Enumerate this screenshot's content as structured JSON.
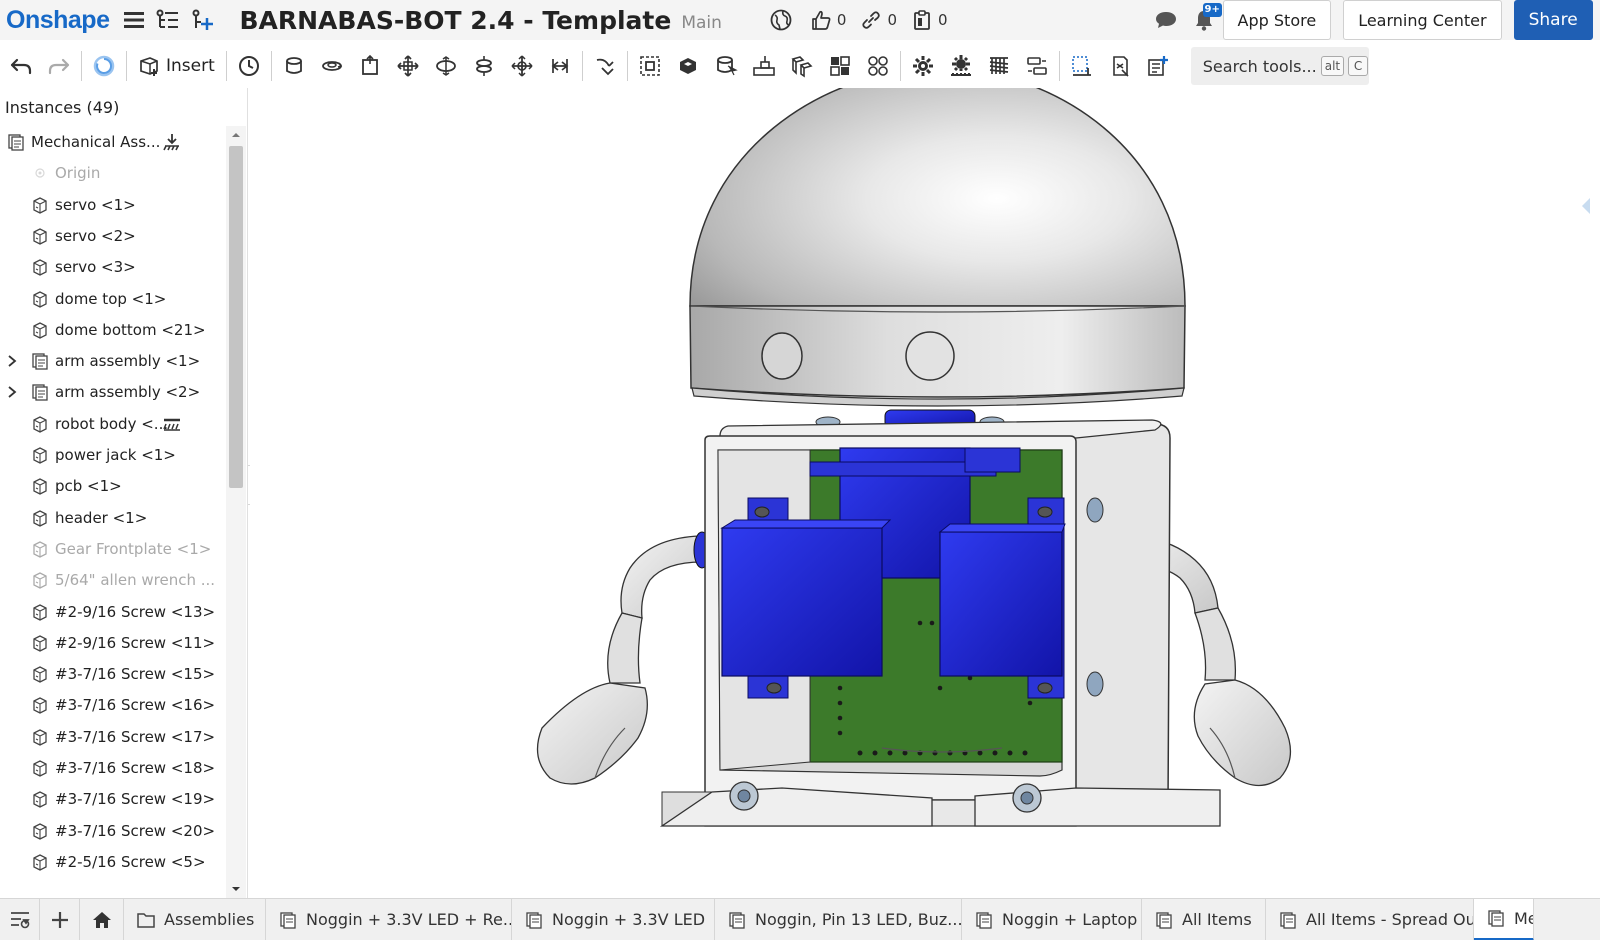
{
  "header": {
    "logo": "Onshape",
    "document_title": "BARNABAS-BOT 2.4 - Template",
    "branch": "Main",
    "likes": "0",
    "links": "0",
    "copies": "0",
    "notification_badge": "9+",
    "app_store": "App Store",
    "learning_center": "Learning Center",
    "share": "Share"
  },
  "toolbar": {
    "insert_label": "Insert",
    "search_placeholder": "Search tools...",
    "shortcut_key1": "alt",
    "shortcut_key2": "C"
  },
  "panel": {
    "title": "Instances (49)",
    "items": [
      {
        "label": "Mechanical Ass...",
        "icon": "assembly-icon",
        "level": 0,
        "state": "normal",
        "caret": false,
        "suffix": "ground-icon"
      },
      {
        "label": "Origin",
        "icon": "origin-icon",
        "level": 1,
        "state": "dim",
        "caret": false
      },
      {
        "label": "servo <1>",
        "icon": "part-icon",
        "level": 1,
        "state": "normal",
        "caret": false
      },
      {
        "label": "servo <2>",
        "icon": "part-icon",
        "level": 1,
        "state": "normal",
        "caret": false
      },
      {
        "label": "servo <3>",
        "icon": "part-icon",
        "level": 1,
        "state": "normal",
        "caret": false
      },
      {
        "label": "dome top <1>",
        "icon": "part-icon",
        "level": 1,
        "state": "normal",
        "caret": false
      },
      {
        "label": "dome bottom <21>",
        "icon": "part-icon",
        "level": 1,
        "state": "normal",
        "caret": false
      },
      {
        "label": "arm assembly <1>",
        "icon": "assembly-icon",
        "level": 1,
        "state": "normal",
        "caret": true
      },
      {
        "label": "arm assembly <2>",
        "icon": "assembly-icon",
        "level": 1,
        "state": "normal",
        "caret": true
      },
      {
        "label": "robot body <...",
        "icon": "part-icon",
        "level": 1,
        "state": "normal",
        "caret": false,
        "suffix": "fixed-icon"
      },
      {
        "label": "power jack <1>",
        "icon": "part-icon",
        "level": 1,
        "state": "normal",
        "caret": false
      },
      {
        "label": "pcb <1>",
        "icon": "part-icon",
        "level": 1,
        "state": "normal",
        "caret": false
      },
      {
        "label": "header <1>",
        "icon": "part-icon",
        "level": 1,
        "state": "normal",
        "caret": false
      },
      {
        "label": "Gear Frontplate <1>",
        "icon": "part-icon",
        "level": 1,
        "state": "dim",
        "caret": false
      },
      {
        "label": "5/64\" allen wrench ...",
        "icon": "part-icon",
        "level": 1,
        "state": "dim",
        "caret": false
      },
      {
        "label": "#2-9/16 Screw <13>",
        "icon": "part-icon",
        "level": 1,
        "state": "normal",
        "caret": false
      },
      {
        "label": "#2-9/16 Screw <11>",
        "icon": "part-icon",
        "level": 1,
        "state": "normal",
        "caret": false
      },
      {
        "label": "#3-7/16 Screw <15>",
        "icon": "part-icon",
        "level": 1,
        "state": "normal",
        "caret": false
      },
      {
        "label": "#3-7/16 Screw <16>",
        "icon": "part-icon",
        "level": 1,
        "state": "normal",
        "caret": false
      },
      {
        "label": "#3-7/16 Screw <17>",
        "icon": "part-icon",
        "level": 1,
        "state": "normal",
        "caret": false
      },
      {
        "label": "#3-7/16 Screw <18>",
        "icon": "part-icon",
        "level": 1,
        "state": "normal",
        "caret": false
      },
      {
        "label": "#3-7/16 Screw <19>",
        "icon": "part-icon",
        "level": 1,
        "state": "normal",
        "caret": false
      },
      {
        "label": "#3-7/16 Screw <20>",
        "icon": "part-icon",
        "level": 1,
        "state": "normal",
        "caret": false
      },
      {
        "label": "#2-5/16 Screw <5>",
        "icon": "part-icon",
        "level": 1,
        "state": "normal",
        "caret": false
      }
    ]
  },
  "tabs": [
    {
      "label": "Assemblies",
      "icon": "folder-icon"
    },
    {
      "label": "Noggin + 3.3V LED + Re...",
      "icon": "assembly-tab-icon"
    },
    {
      "label": "Noggin + 3.3V LED",
      "icon": "assembly-tab-icon"
    },
    {
      "label": "Noggin, Pin 13 LED, Buz...",
      "icon": "assembly-tab-icon"
    },
    {
      "label": "Noggin + Laptop",
      "icon": "assembly-tab-icon"
    },
    {
      "label": "All Items",
      "icon": "assembly-tab-icon"
    },
    {
      "label": "All Items - Spread Out",
      "icon": "assembly-tab-icon"
    },
    {
      "label": "Mech",
      "icon": "assembly-tab-icon"
    }
  ],
  "colors": {
    "accent": "#1769c7",
    "share_button": "#1f5fb4",
    "servo_blue": "#1a22d9",
    "pcb_green": "#3c7a2a",
    "body_grey": "#e8e8e8"
  }
}
